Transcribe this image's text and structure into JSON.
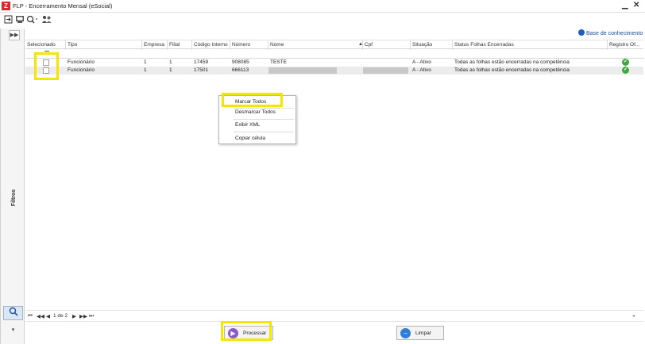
{
  "window": {
    "title": "FLP - Encerramento Mensal (eSocial)",
    "app_icon": "Z",
    "minimize": "▁",
    "close": "✕"
  },
  "toolbar": {
    "icons": [
      "exit-icon",
      "report-icon",
      "search-dropdown-icon",
      "users-icon"
    ]
  },
  "left_panel": {
    "expand": "▶▶",
    "filters_label": "Filtros",
    "search_glyph": "🔍",
    "down_glyph": "▾"
  },
  "knowledge_base": {
    "label": "Base de conhecimento"
  },
  "grid": {
    "columns": [
      "Selecionado",
      "Tipo",
      "Empresa",
      "Filial",
      "Código Interno",
      "Número",
      "Nome",
      "Cpf",
      "Situação",
      "Status Folhas Encerradas",
      "Registro Of..."
    ],
    "sort_indicator": "▲",
    "rows": [
      {
        "tipo": "Funcionário",
        "empresa": "1",
        "filial": "1",
        "codigo": "17459",
        "numero": "908085",
        "nome": "TESTE",
        "situacao": "A - Ativo",
        "status": "Todas as folhas estão encerradas na competência",
        "registro_ok": true
      },
      {
        "tipo": "Funcionário",
        "empresa": "1",
        "filial": "1",
        "codigo": "17501",
        "numero": "666113",
        "nome": "",
        "situacao": "A - Ativo",
        "status": "Todas as folhas estão encerradas na competência",
        "registro_ok": true
      }
    ]
  },
  "context_menu": {
    "items": [
      "Marcar Todos",
      "Desmarcar Todos",
      "Exibir XML",
      "Copiar célula"
    ]
  },
  "pager": {
    "first": "⏮",
    "prev_fast": "◀◀",
    "prev": "◀",
    "page_text": "1 de 2",
    "next": "▶",
    "next_fast": "▶▶",
    "last": "⏭",
    "end_marker": "◂"
  },
  "buttons": {
    "processar": "Processar",
    "limpar": "Limpar"
  },
  "colors": {
    "highlight": "#f3e600",
    "ok_green": "#3ea73e",
    "processar_icon": "#8a5cc7",
    "limpar_icon": "#2f7fd6"
  }
}
